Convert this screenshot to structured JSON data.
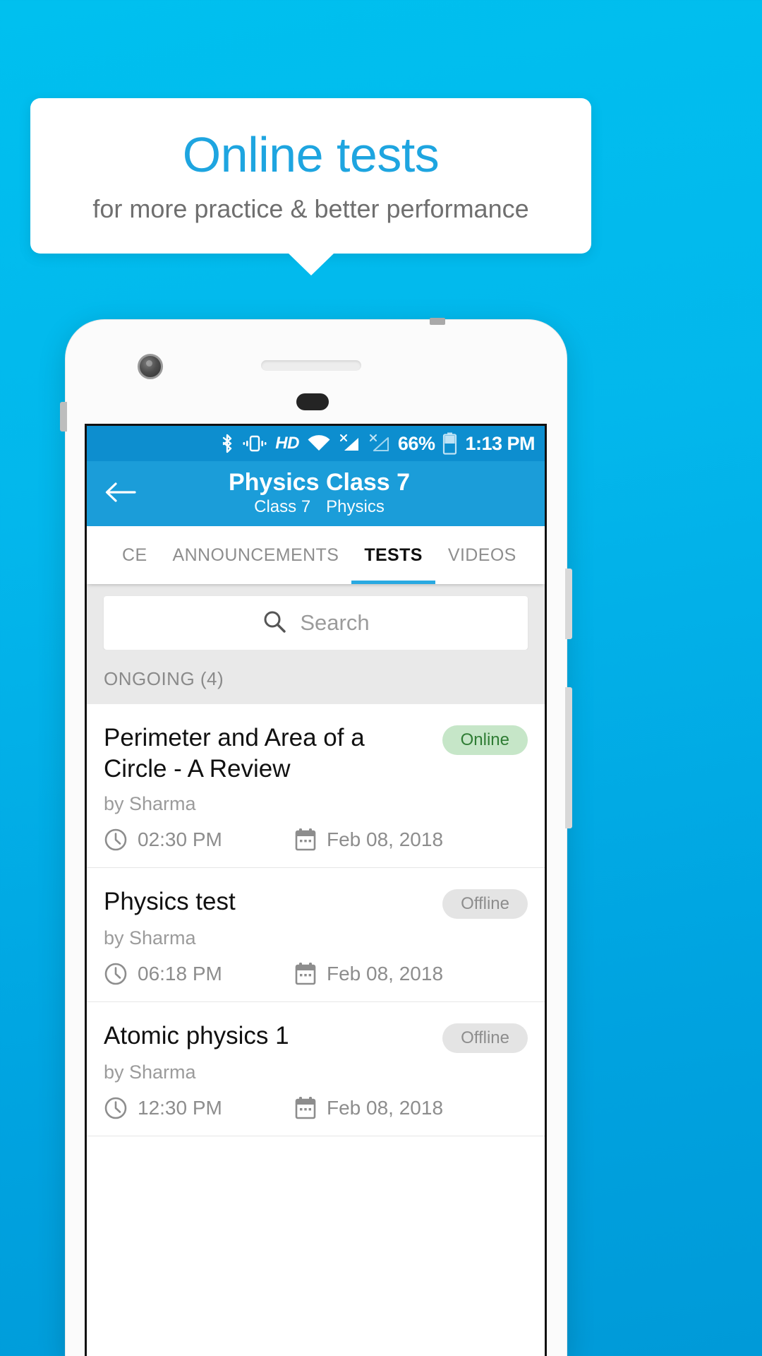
{
  "promo": {
    "title": "Online tests",
    "subtitle": "for more practice & better performance",
    "title_color": "#1ea5e0",
    "subtitle_color": "#6f6f6f",
    "background_color": "#03b7ec"
  },
  "statusbar": {
    "battery_percent": "66%",
    "time": "1:13 PM",
    "hd_label": "HD",
    "icons": [
      "bluetooth-icon",
      "vibrate-icon",
      "hd-icon",
      "wifi-icon",
      "signal-no-sim-1-icon",
      "signal-no-sim-2-icon",
      "battery-icon"
    ],
    "background_color": "#0d8ecf"
  },
  "appbar": {
    "title": "Physics Class 7",
    "subtitle_class": "Class 7",
    "subtitle_subject": "Physics",
    "back_icon": "arrow-left-icon",
    "background_color": "#1b9dd9"
  },
  "tabs": [
    {
      "label": "CE",
      "active": false
    },
    {
      "label": "ANNOUNCEMENTS",
      "active": false
    },
    {
      "label": "TESTS",
      "active": true
    },
    {
      "label": "VIDEOS",
      "active": false
    }
  ],
  "tab_indicator_color": "#29a9e1",
  "search": {
    "placeholder": "Search",
    "value": "",
    "icon": "search-icon"
  },
  "section": {
    "header": "ONGOING (4)"
  },
  "tests": [
    {
      "title": "Perimeter and Area of a Circle - A Review",
      "author": "by Sharma",
      "status": "Online",
      "status_type": "online",
      "time": "02:30 PM",
      "date": "Feb 08, 2018"
    },
    {
      "title": "Physics test",
      "author": "by Sharma",
      "status": "Offline",
      "status_type": "offline",
      "time": "06:18 PM",
      "date": "Feb 08, 2018"
    },
    {
      "title": "Atomic physics 1",
      "author": "by Sharma",
      "status": "Offline",
      "status_type": "offline",
      "time": "12:30 PM",
      "date": "Feb 08, 2018"
    }
  ],
  "badge_colors": {
    "online_bg": "#c6e6c8",
    "online_text": "#2f7d34",
    "offline_bg": "#e4e4e4",
    "offline_text": "#8d8d8d"
  }
}
